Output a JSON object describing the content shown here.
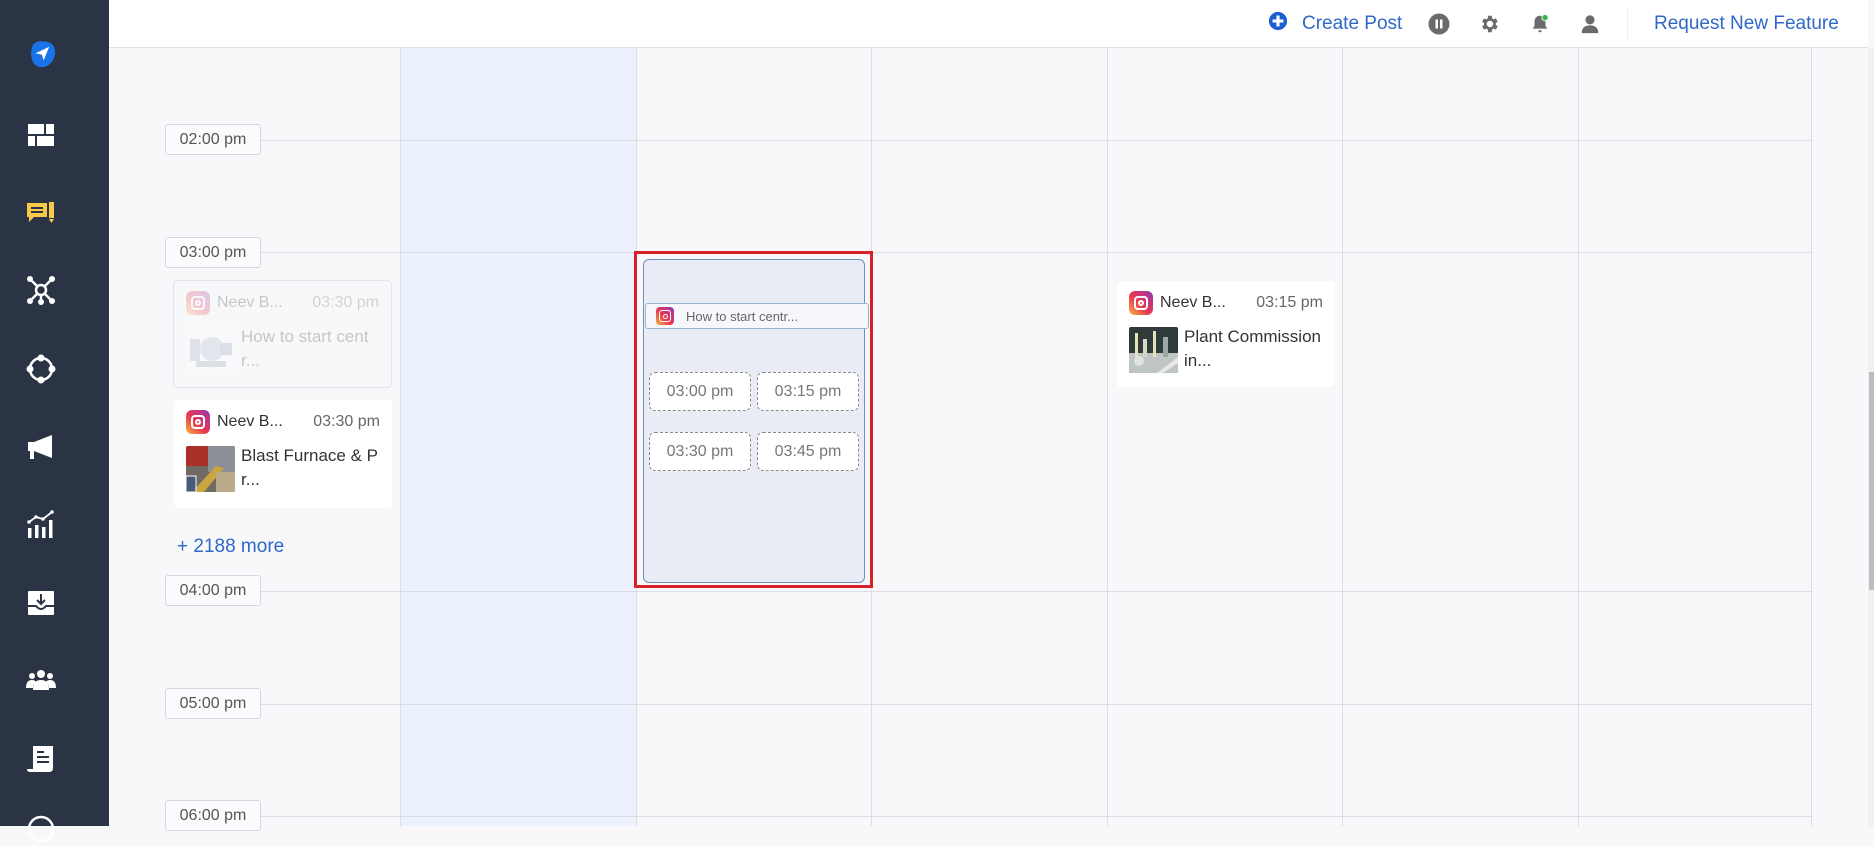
{
  "sidebar": {
    "items": [
      {
        "name": "logo-send",
        "active": false
      },
      {
        "name": "dashboard"
      },
      {
        "name": "compose-notes",
        "active": true
      },
      {
        "name": "network"
      },
      {
        "name": "integrations"
      },
      {
        "name": "campaigns"
      },
      {
        "name": "analytics"
      },
      {
        "name": "inbox"
      },
      {
        "name": "team"
      },
      {
        "name": "reports"
      },
      {
        "name": "help"
      }
    ]
  },
  "topbar": {
    "create_post_label": "Create Post",
    "request_feature_label": "Request New Feature",
    "notification_dot_color": "#3cb64a",
    "link_color": "#2f68c8"
  },
  "calendar": {
    "time_labels": [
      "02:00 pm",
      "03:00 pm",
      "04:00 pm",
      "05:00 pm",
      "06:00 pm"
    ],
    "today_column_index": 0,
    "more_link": "+ 2188 more",
    "posts": [
      {
        "account": "Neev B...",
        "time": "03:30 pm",
        "title": "How to start cent r...",
        "state": "dragging-ghost",
        "column": -1
      },
      {
        "account": "Neev B...",
        "time": "03:30 pm",
        "title": "Blast Furnace & P r...",
        "state": "normal",
        "column": -1
      },
      {
        "account": "Neev B...",
        "time": "03:15 pm",
        "title": "Plant Commission in...",
        "state": "normal",
        "column": 3
      }
    ],
    "drop_target": {
      "dragged_title": "How to start centr...",
      "slots": [
        "03:00 pm",
        "03:15 pm",
        "03:30 pm",
        "03:45 pm"
      ],
      "highlight_color": "#d92027"
    }
  }
}
